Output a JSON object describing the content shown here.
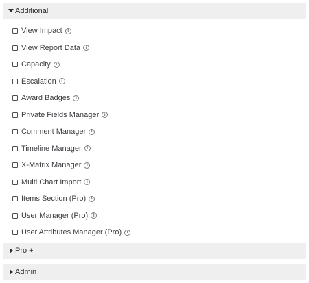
{
  "sections": {
    "additional": {
      "label": "Additional",
      "expanded": true,
      "caret_icon": "caret-down-icon"
    },
    "pro_plus": {
      "label": "Pro +",
      "expanded": false,
      "caret_icon": "caret-right-icon"
    },
    "admin": {
      "label": "Admin",
      "expanded": false,
      "caret_icon": "caret-right-icon"
    }
  },
  "additional_items": [
    {
      "label": "View Impact",
      "checked": false
    },
    {
      "label": "View Report Data",
      "checked": false
    },
    {
      "label": "Capacity",
      "checked": false
    },
    {
      "label": "Escalation",
      "checked": false
    },
    {
      "label": "Award Badges",
      "checked": false
    },
    {
      "label": "Private Fields Manager",
      "checked": false
    },
    {
      "label": "Comment Manager",
      "checked": false
    },
    {
      "label": "Timeline Manager",
      "checked": false
    },
    {
      "label": "X-Matrix Manager",
      "checked": false
    },
    {
      "label": "Multi Chart Import",
      "checked": false
    },
    {
      "label": "Items Section (Pro)",
      "checked": false
    },
    {
      "label": "User Manager (Pro)",
      "checked": false
    },
    {
      "label": "User Attributes Manager (Pro)",
      "checked": false
    }
  ],
  "info_icon": {
    "glyph": "i",
    "name": "info-icon"
  },
  "colors": {
    "header_bg": "#efefef",
    "text": "#3b3d40"
  }
}
